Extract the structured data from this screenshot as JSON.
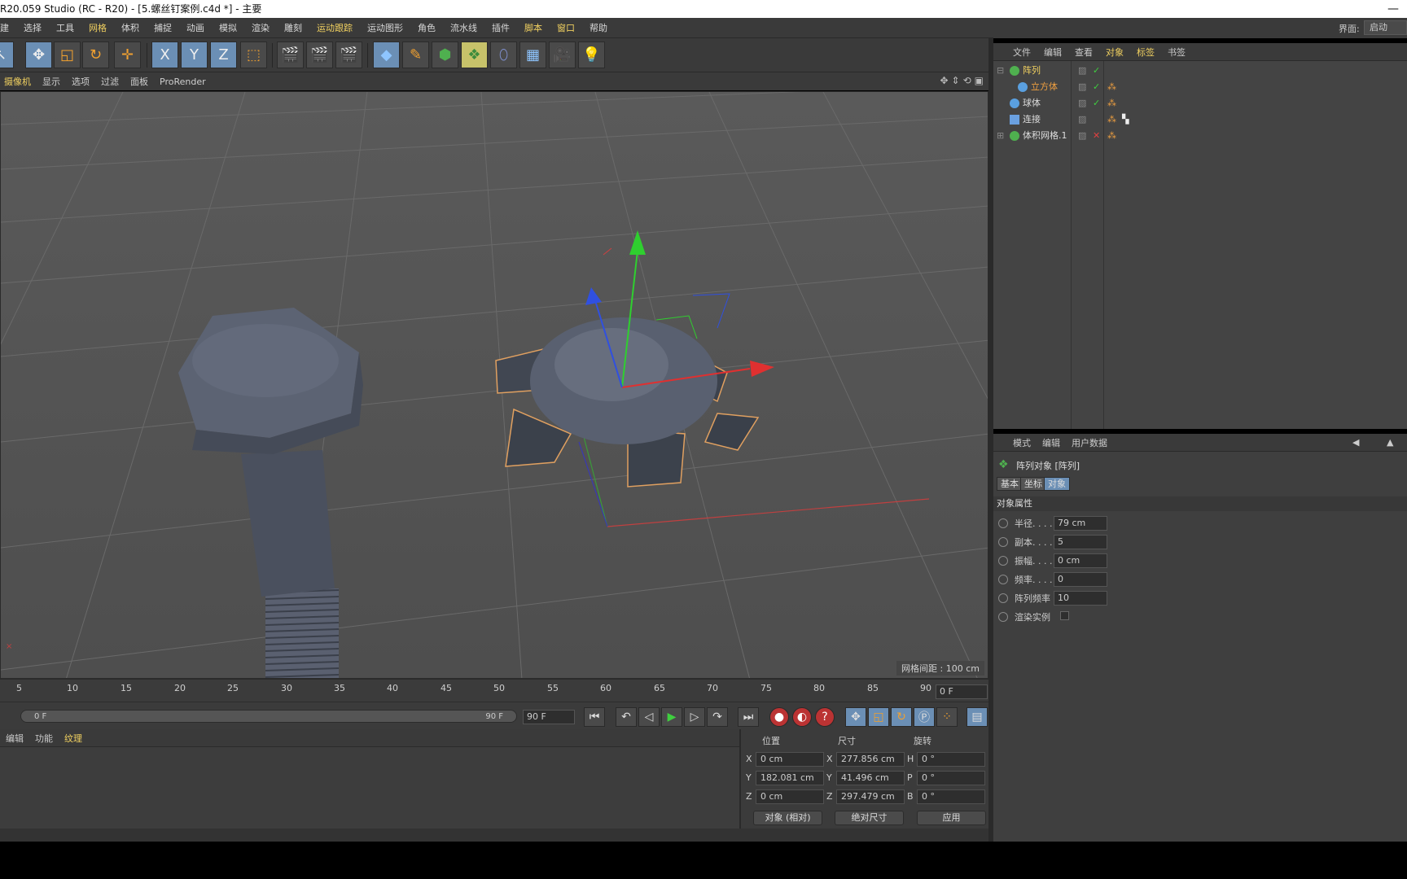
{
  "window": {
    "title": "R20.059 Studio (RC - R20) - [5.螺丝钉案例.c4d *] - 主要",
    "minimize": "—"
  },
  "menubar": [
    "建",
    "选择",
    "工具",
    "网格",
    "体积",
    "捕捉",
    "动画",
    "模拟",
    "渲染",
    "雕刻",
    "运动跟踪",
    "运动图形",
    "角色",
    "流水线",
    "插件",
    "脚本",
    "窗口",
    "帮助"
  ],
  "layout": {
    "label": "界面:",
    "value": "启动"
  },
  "toolbar": {
    "icons": [
      "select-icon",
      "move-icon",
      "scale-icon",
      "rotate-icon",
      "axis-icon",
      "x-axis-icon",
      "y-axis-icon",
      "z-axis-icon",
      "coordinate-system-icon",
      "render-view-icon",
      "render-picture-icon",
      "render-settings-icon",
      "cube-icon",
      "pen-icon",
      "subdivision-icon",
      "array-icon",
      "deformer-icon",
      "floor-icon",
      "camera-icon",
      "light-icon"
    ],
    "x": "X",
    "y": "Y",
    "z": "Z"
  },
  "viewport": {
    "menu": [
      "摄像机",
      "显示",
      "选项",
      "过滤",
      "面板",
      "ProRender"
    ],
    "grid_label": "网格间距 : 100 cm"
  },
  "timeline": {
    "ticks": [
      "5",
      "10",
      "15",
      "20",
      "25",
      "30",
      "35",
      "40",
      "45",
      "50",
      "55",
      "60",
      "65",
      "70",
      "75",
      "80",
      "85",
      "90"
    ],
    "current_frame": "0 F",
    "scrub_start": "0 F",
    "scrub_end": "90 F",
    "end_frame": "90 F"
  },
  "material_bar": [
    "编辑",
    "功能",
    "纹理"
  ],
  "coords": {
    "headers": [
      "位置",
      "尺寸",
      "旋转"
    ],
    "rows": [
      {
        "axis": "X",
        "pos": "0 cm",
        "size_axis": "X",
        "size": "277.856 cm",
        "rot_axis": "H",
        "rot": "0 °"
      },
      {
        "axis": "Y",
        "pos": "182.081 cm",
        "size_axis": "Y",
        "size": "41.496 cm",
        "rot_axis": "P",
        "rot": "0 °"
      },
      {
        "axis": "Z",
        "pos": "0 cm",
        "size_axis": "Z",
        "size": "297.479 cm",
        "rot_axis": "B",
        "rot": "0 °"
      }
    ],
    "mode": "对象 (相对)",
    "size_mode": "绝对尺寸",
    "apply": "应用"
  },
  "object_manager": {
    "menu": [
      "文件",
      "编辑",
      "查看",
      "对象",
      "标签",
      "书签"
    ],
    "objects": [
      {
        "name": "阵列",
        "color": "#f0d060",
        "icon_color": "#4fb04f",
        "indent": 0
      },
      {
        "name": "立方体",
        "color": "#f0a040",
        "icon_color": "#5aa0e0",
        "indent": 1
      },
      {
        "name": "球体",
        "color": "#dddddd",
        "icon_color": "#5aa0e0",
        "indent": 0
      },
      {
        "name": "连接",
        "color": "#dddddd",
        "icon_color": "#6aa0e0",
        "indent": 0
      },
      {
        "name": "体积网格.1",
        "color": "#dddddd",
        "icon_color": "#4fb04f",
        "indent": 0
      }
    ]
  },
  "attributes": {
    "menu": [
      "模式",
      "编辑",
      "用户数据"
    ],
    "title": "阵列对象 [阵列]",
    "tabs": [
      "基本",
      "坐标",
      "对象"
    ],
    "section": "对象属性",
    "fields": [
      {
        "label": "半径. . . .",
        "value": "79 cm"
      },
      {
        "label": "副本. . . .",
        "value": "5"
      },
      {
        "label": "振幅. . . .",
        "value": "0 cm"
      },
      {
        "label": "频率. . . .",
        "value": "0"
      },
      {
        "label": "阵列频率",
        "value": "10"
      }
    ],
    "render_instances": "渲染实例"
  }
}
